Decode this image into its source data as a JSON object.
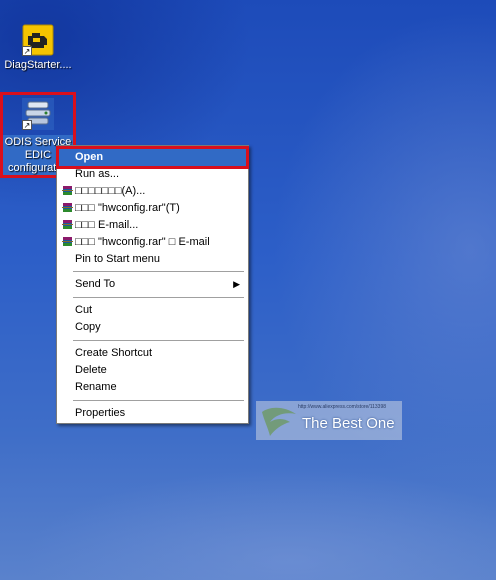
{
  "desktop": {
    "icons": [
      {
        "label": "DiagStarter....",
        "icon": "engine-warning-icon"
      },
      {
        "label_lines": [
          "ODIS Service",
          "EDIC",
          "configurati..."
        ],
        "icon": "network-config-icon"
      }
    ]
  },
  "context_menu": {
    "items": {
      "open": "Open",
      "run_as": "Run as...",
      "add_archive": "□□□□□□□(A)...",
      "add_to_rar": "□□□ \"hwconfig.rar\"(T)",
      "compress_email": "□□□ E-mail...",
      "compress_rar_email": "□□□ \"hwconfig.rar\" □ E-mail",
      "pin_start": "Pin to Start menu",
      "send_to": "Send To",
      "cut": "Cut",
      "copy": "Copy",
      "create_shortcut": "Create Shortcut",
      "delete": "Delete",
      "rename": "Rename",
      "properties": "Properties"
    }
  },
  "watermark": {
    "url": "http://www.aliexpress.com/store/113398",
    "text": "The Best One"
  },
  "colors": {
    "highlight_red": "#d90f1c",
    "selection_blue": "#316ac5",
    "desktop_blue": "#2d5fc8"
  }
}
